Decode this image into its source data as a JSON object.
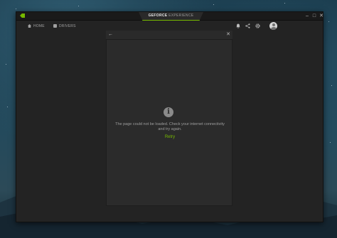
{
  "app": {
    "brand": "GEFORCE",
    "title_suffix": "EXPERIENCE",
    "accent_color": "#76b900",
    "logo_icon": "nvidia-logo-icon"
  },
  "window_controls": {
    "minimize": "–",
    "maximize": "□",
    "close": "✕"
  },
  "nav": {
    "items": [
      {
        "label": "HOME",
        "icon": "home-icon"
      },
      {
        "label": "DRIVERS",
        "icon": "drivers-icon"
      }
    ],
    "right_icons": [
      "notification-icon",
      "share-icon",
      "settings-icon",
      "avatar-icon"
    ]
  },
  "modal": {
    "back_icon": "←",
    "close_icon": "✕",
    "info_icon_glyph": "i",
    "message": "The page could not be loaded. Check your internet connectivity and try again.",
    "retry_label": "Retry"
  }
}
